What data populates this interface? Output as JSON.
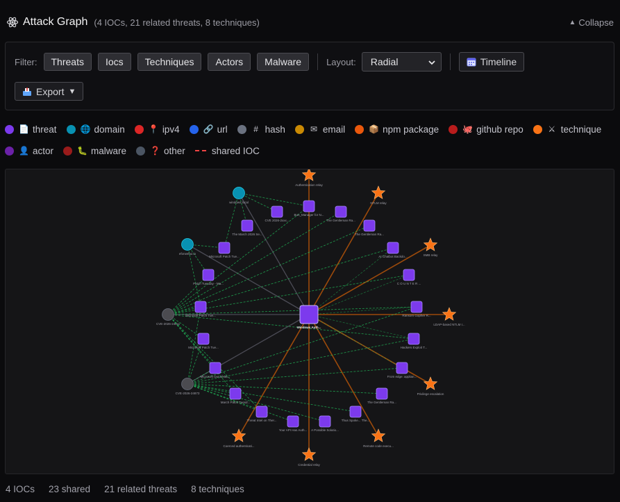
{
  "header": {
    "title": "Attack Graph",
    "subtitle": "(4 IOCs, 21 related threats, 8 techniques)",
    "collapse_label": "Collapse"
  },
  "filter": {
    "label": "Filter:",
    "buttons": [
      "Threats",
      "Iocs",
      "Techniques",
      "Actors",
      "Malware"
    ],
    "layout_label": "Layout:",
    "layout_value": "Radial",
    "timeline_label": "Timeline",
    "export_label": "Export"
  },
  "legend": {
    "row1": [
      {
        "label": "threat",
        "color": "#7c3aed",
        "icon": "document-icon"
      },
      {
        "label": "domain",
        "color": "#0891b2",
        "icon": "globe-icon"
      },
      {
        "label": "ipv4",
        "color": "#dc2626",
        "icon": "pin-icon"
      },
      {
        "label": "url",
        "color": "#2563eb",
        "icon": "link-icon"
      },
      {
        "label": "hash",
        "color": "#6b7280",
        "icon": "hash-icon"
      },
      {
        "label": "email",
        "color": "#ca8a04",
        "icon": "email-icon"
      },
      {
        "label": "npm package",
        "color": "#ea580c",
        "icon": "package-icon"
      },
      {
        "label": "github repo",
        "color": "#b91c1c",
        "icon": "octopus-icon"
      },
      {
        "label": "technique",
        "color": "#f97316",
        "icon": "swords-icon"
      }
    ],
    "row2": [
      {
        "label": "actor",
        "color": "#6b21a8",
        "icon": "person-icon"
      },
      {
        "label": "malware",
        "color": "#991b1b",
        "icon": "bug-icon"
      },
      {
        "label": "other",
        "color": "#4b5563",
        "icon": "question-icon"
      }
    ],
    "shared_label": "shared IOC"
  },
  "graph": {
    "center": {
      "label": "Windows Auth..."
    },
    "threats": [
      "Bun_Manager for N...",
      "The Gentleman Ra...",
      "The Gentleman Ra...",
      "AI Chatbot Backdo...",
      "C O U N T E R ...",
      "Ransom Gopher R...",
      "Hackers Exploit T...",
      "From edge: applian...",
      "The Gentleman Ra...",
      "Thus Spoke... The...",
      "A Possible Solutio...",
      "Your API Has Auth...",
      "Threat Intel on Ther...",
      "March Patch Tuesd...",
      "Microsoft Out-of-Ba...",
      "Microsoft Patch Tue...",
      "Microsoft Patch Tue...",
      "Patch Tuesday - Ma...",
      "Microsoft Patch Tue...",
      "The March 2026 Se...",
      "CVE 2026-2xxx..."
    ],
    "techniques": [
      "Authentication relay",
      "NTLM relay",
      "SMB relay",
      "LDAP-based NTLM r...",
      "Privilege escalation",
      "Remote code execu...",
      "Credential relay",
      "Coerced authenticati..."
    ],
    "iocs": [
      "windows.local",
      "eforwebui.io",
      "CVE-2026-24xxx",
      "CVE-2026-24873"
    ]
  },
  "footer": {
    "iocs": "4 IOCs",
    "shared": "23 shared",
    "threats": "21 related threats",
    "techniques": "8 techniques"
  }
}
